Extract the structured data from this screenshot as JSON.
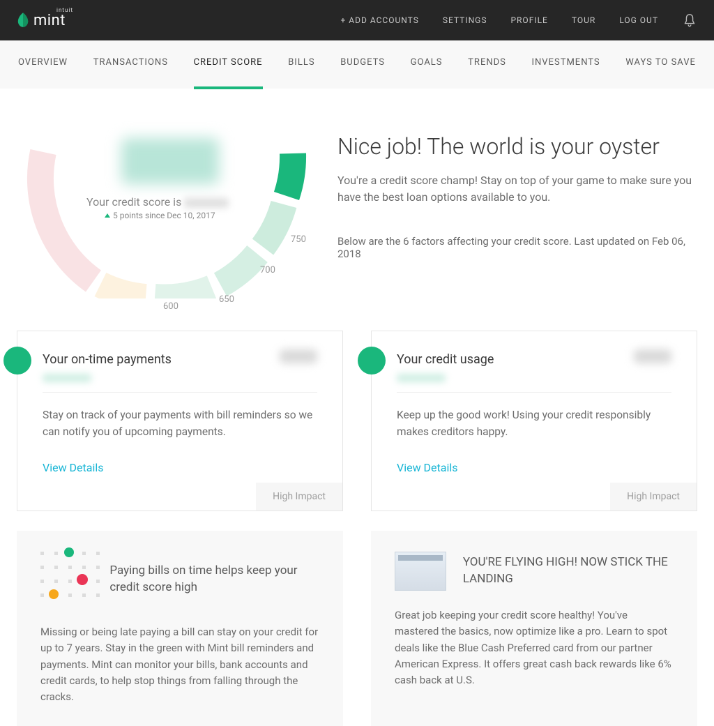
{
  "brand": {
    "name": "mint",
    "parent": "intuit"
  },
  "topnav": {
    "items": [
      {
        "label": "+ ADD ACCOUNTS",
        "name": "add-accounts-link"
      },
      {
        "label": "SETTINGS",
        "name": "settings-link"
      },
      {
        "label": "PROFILE",
        "name": "profile-link"
      },
      {
        "label": "TOUR",
        "name": "tour-link"
      },
      {
        "label": "LOG OUT",
        "name": "logout-link"
      }
    ]
  },
  "secnav": {
    "items": [
      {
        "label": "OVERVIEW",
        "name": "tab-overview",
        "active": false
      },
      {
        "label": "TRANSACTIONS",
        "name": "tab-transactions",
        "active": false
      },
      {
        "label": "CREDIT SCORE",
        "name": "tab-credit-score",
        "active": true
      },
      {
        "label": "BILLS",
        "name": "tab-bills",
        "active": false
      },
      {
        "label": "BUDGETS",
        "name": "tab-budgets",
        "active": false
      },
      {
        "label": "GOALS",
        "name": "tab-goals",
        "active": false
      },
      {
        "label": "TRENDS",
        "name": "tab-trends",
        "active": false
      },
      {
        "label": "INVESTMENTS",
        "name": "tab-investments",
        "active": false
      },
      {
        "label": "WAYS TO SAVE",
        "name": "tab-ways-to-save",
        "active": false
      }
    ]
  },
  "gauge": {
    "score_label_prefix": "Your credit score is",
    "delta_text": "5 points since Dec 10, 2017",
    "ticks": {
      "600": "600",
      "650": "650",
      "700": "700",
      "750": "750"
    }
  },
  "hero": {
    "title": "Nice job! The world is your oyster",
    "body": "You're a credit score champ! Stay on top of your game to make sure you have the best loan options available to you.",
    "subhead": "Below are the 6 factors affecting your credit score. Last updated on Feb 06, 2018"
  },
  "factors": [
    {
      "title": "Your on-time payments",
      "desc": "Stay on track of your payments with bill reminders so we can notify you of upcoming payments.",
      "cta": "View Details",
      "impact": "High Impact"
    },
    {
      "title": "Your credit usage",
      "desc": "Keep up the good work! Using your credit responsibly makes creditors happy.",
      "cta": "View Details",
      "impact": "High Impact"
    }
  ],
  "info": [
    {
      "title": "Paying bills on time helps keep your credit score high",
      "body": "Missing or being late paying a bill can stay on your credit for up to 7 years. Stay in the green with Mint bill reminders and payments. Mint can monitor your bills, bank accounts and credit cards, to help stop things from falling through the cracks."
    },
    {
      "title": "YOU'RE FLYING HIGH! NOW STICK THE LANDING",
      "body": "Great job keeping your credit score healthy! You've mastered the basics, now optimize like a pro. Learn to spot deals like the Blue Cash Preferred card from our partner American Express. It offers great cash back rewards like 6% cash back at U.S."
    }
  ],
  "colors": {
    "accent": "#1ab77c",
    "link": "#17b5d5"
  }
}
